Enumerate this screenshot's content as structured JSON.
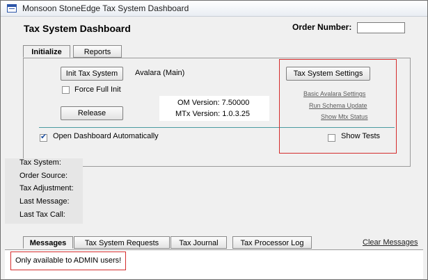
{
  "window": {
    "title": "Monsoon StoneEdge Tax System Dashboard"
  },
  "header": {
    "title": "Tax System Dashboard",
    "order_number_label": "Order Number:",
    "order_number_value": ""
  },
  "tabs_top": [
    {
      "label": "Initialize",
      "active": true
    },
    {
      "label": "Reports",
      "active": false
    }
  ],
  "initialize": {
    "init_button": "Init Tax System",
    "provider": "Avalara (Main)",
    "force_full_init_label": "Force Full Init",
    "force_full_init_checked": false,
    "release_button": "Release",
    "om_version": "OM Version: 7.50000",
    "mtx_version": "MTx Version: 1.0.3.25",
    "open_dashboard_label": "Open Dashboard Automatically",
    "open_dashboard_checked": true,
    "settings_button": "Tax System Settings",
    "links": [
      "Basic Avalara Settings",
      "Run Schema Update",
      "Show Mtx Status"
    ],
    "show_tests_label": "Show Tests",
    "show_tests_checked": false
  },
  "info_labels": [
    "Tax System:",
    "Order Source:",
    "Tax Adjustment:",
    "Last Message:",
    "Last Tax Call:"
  ],
  "tabs_bottom": [
    {
      "label": "Messages",
      "active": true
    },
    {
      "label": "Tax System Requests",
      "active": false
    },
    {
      "label": "Tax Journal",
      "active": false
    },
    {
      "label": "Tax Processor Log",
      "active": false
    }
  ],
  "clear_messages": "Clear Messages",
  "message_text": "Only available to ADMIN users!",
  "colors": {
    "annotation_red": "#d42b2b",
    "divider": "#4a9aa0",
    "check_blue": "#1b4ea0"
  }
}
